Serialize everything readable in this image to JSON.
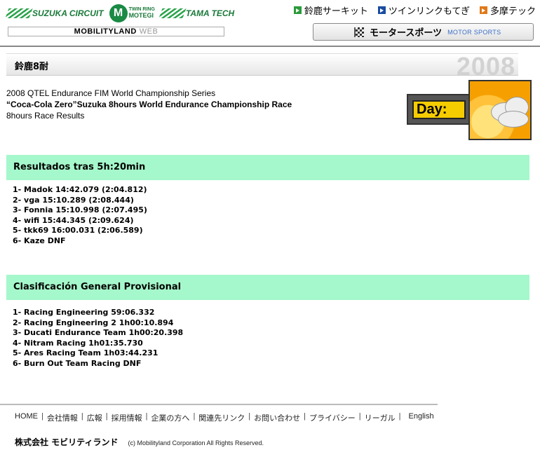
{
  "header": {
    "logos": {
      "suzuka": "SUZUKA CIRCUIT",
      "motegi_top": "TWIN RING",
      "motegi_bottom": "MOTEGI",
      "tamatech": "TAMA TECH"
    },
    "mobilityland": "MOBILITYLAND",
    "mobilityland_web": "WEB",
    "top_links": [
      {
        "label": "鈴鹿サーキット",
        "icon": "green-arrow-icon",
        "color": "#2a9a3a"
      },
      {
        "label": "ツインリンクもてぎ",
        "icon": "blue-arrow-icon",
        "color": "#1a4ca0"
      },
      {
        "label": "多摩テック",
        "icon": "orange-arrow-icon",
        "color": "#e07818"
      }
    ],
    "motorsports_jp": "モータースポーツ",
    "motorsports_en": "MOTOR SPORTS"
  },
  "title_bar": {
    "title": "鈴鹿8耐",
    "year": "2008"
  },
  "intro": {
    "line1": "2008 QTEL Endurance FIM World Championship Series",
    "line2": "“Coca-Cola Zero”Suzuka 8hours World Endurance Championship Race",
    "line3": "8hours Race Results"
  },
  "weather": {
    "label": "Day:",
    "icon": "partly-cloudy-icon"
  },
  "section1": {
    "heading": "Resultados tras 5h:20min",
    "items": [
      "1- Madok 14:42.079 (2:04.812)",
      "2- vga 15:10.289 (2:08.444)",
      "3- Fonnia 15:10.998 (2:07.495)",
      "4- wifi 15:44.345 (2:09.624)",
      "5- tkk69 16:00.031 (2:06.589)",
      "6- Kaze DNF"
    ]
  },
  "section2": {
    "heading": "Clasificación General Provisional",
    "items": [
      "1- Racing Engineering 59:06.332",
      "2- Racing Engineering 2 1h00:10.894",
      "3- Ducati Endurance Team 1h00:20.398",
      "4- Nitram Racing 1h01:35.730",
      "5- Ares Racing Team 1h03:44.231",
      "6- Burn Out Team Racing DNF"
    ]
  },
  "footer": {
    "nav": [
      "HOME",
      "会社情報",
      "広報",
      "採用情報",
      "企業の方へ",
      "関連先リンク",
      "お問い合わせ",
      "プライバシー",
      "リーガル",
      "English"
    ],
    "corp_name": "株式会社 モビリティランド",
    "copyright": "(c) Mobilityland Corporation All Rights Reserved."
  },
  "colors": {
    "section_bg": "#a5f8cb",
    "brand_green": "#1a7a3a"
  }
}
